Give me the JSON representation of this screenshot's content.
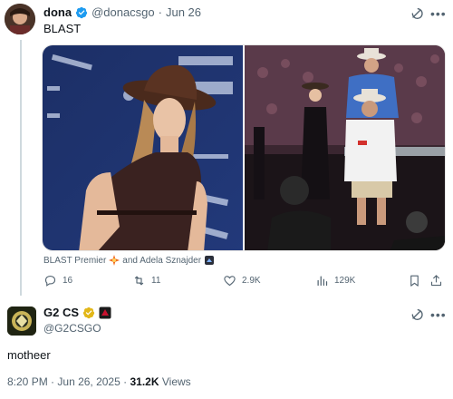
{
  "tweet1": {
    "name": "dona",
    "handle": "@donacsgo",
    "dot": "·",
    "date": "Jun 26",
    "text": "BLAST",
    "tags": {
      "first": "BLAST Premier",
      "connector": "and Adela Sznajder"
    },
    "stats": {
      "replies": "16",
      "retweets": "11",
      "likes": "2.9K",
      "views": "129K"
    }
  },
  "tweet2": {
    "name": "G2 CS",
    "handle": "@G2CSGO",
    "text": "motheer",
    "time": "8:20 PM",
    "dot": "·",
    "date": "Jun 26, 2025",
    "views_count": "31.2K",
    "views_label": "Views"
  },
  "colors": {
    "verified": "#1d9bf0",
    "muted": "#536471",
    "text": "#0f1419"
  },
  "icons": [
    "verified-icon",
    "grok-icon",
    "more-icon",
    "reply-icon",
    "retweet-icon",
    "like-icon",
    "views-icon",
    "bookmark-icon",
    "share-icon",
    "sparkle-icon",
    "square-emoji-icon"
  ]
}
